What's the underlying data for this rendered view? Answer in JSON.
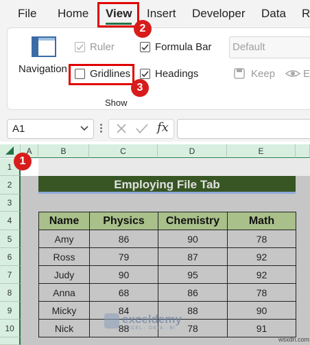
{
  "menu": {
    "tabs": [
      "File",
      "Home",
      "View",
      "Insert",
      "Developer",
      "Data",
      "R"
    ],
    "active_tab": "View",
    "accent": "#217346"
  },
  "ribbon": {
    "navigation_label": "Navigation",
    "ruler_label": "Ruler",
    "ruler_checked": true,
    "ruler_enabled": false,
    "formula_bar_label": "Formula Bar",
    "formula_bar_checked": true,
    "gridlines_label": "Gridlines",
    "gridlines_checked": false,
    "headings_label": "Headings",
    "headings_checked": true,
    "group_label": "Show",
    "sheet_view_default": "Default",
    "keep_label": "Keep",
    "exit_label": "Ex"
  },
  "formula_bar": {
    "name_box": "A1",
    "fx_label": "fx",
    "value": ""
  },
  "badges": [
    "1",
    "2",
    "3"
  ],
  "sheet": {
    "columns": [
      "A",
      "B",
      "C",
      "D",
      "E"
    ],
    "rows": [
      "1",
      "2",
      "3",
      "4",
      "5",
      "6",
      "7",
      "8",
      "9",
      "10"
    ],
    "title": "Employing File Tab",
    "table_headers": [
      "Name",
      "Physics",
      "Chemistry",
      "Math"
    ],
    "table_rows": [
      [
        "Amy",
        "86",
        "90",
        "78"
      ],
      [
        "Ross",
        "79",
        "87",
        "92"
      ],
      [
        "Judy",
        "90",
        "95",
        "92"
      ],
      [
        "Anna",
        "68",
        "86",
        "78"
      ],
      [
        "Micky",
        "84",
        "88",
        "90"
      ],
      [
        "Nick",
        "88",
        "78",
        "91"
      ]
    ]
  },
  "watermark": {
    "brand": "exceldemy",
    "tagline": "EXCEL · DATA · BI",
    "site": "wsxdn.com"
  },
  "colors": {
    "title_fill": "#375623",
    "header_fill": "#a9c08a",
    "highlight_red": "#e00000"
  }
}
